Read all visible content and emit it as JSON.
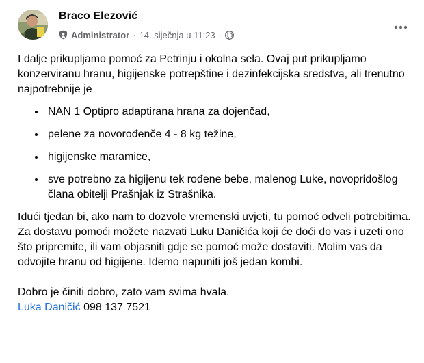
{
  "post": {
    "author": "Braco Elezović",
    "role": "Administrator",
    "separator": "·",
    "timestamp": "14. siječnja u 11:23",
    "audience_icon": "globe-icon",
    "role_icon": "admin-shield-icon",
    "menu_icon": "more-options-icon",
    "intro": "I dalje prikupljamo pomoć za Petrinju i okolna sela. Ovaj put prikupljamo konzerviranu hranu, higijenske potrepštine i dezinfekcijska sredstva, ali trenutno najpotrebnije je",
    "list": [
      "NAN 1 Optipro adaptirana hrana za dojenčad,",
      "pelene za novorođenče 4 - 8 kg težine,",
      "higijenske maramice,",
      "sve potrebno za higijenu tek rođene bebe, malenog Luke, novopridošlog člana obitelji Prašnjak iz Strašnika."
    ],
    "paragraph2": "Idući tjedan bi, ako nam to dozvole vremenski uvjeti, tu pomoć odveli potrebitima. Za dostavu pomoći možete nazvati Luku Daničića koji će doći do vas i uzeti ono što pripremite, ili vam objasniti gdje se pomoć može dostaviti. Molim vas da odvojite hranu od higijene. Idemo napuniti još jedan kombi.",
    "closing": "Dobro je činiti dobro, zato vam svima hvala.",
    "mention": "Luka Daničić",
    "phone": "098 137 7521",
    "colors": {
      "text": "#050505",
      "secondary": "#65676b",
      "link": "#216fdb"
    }
  }
}
